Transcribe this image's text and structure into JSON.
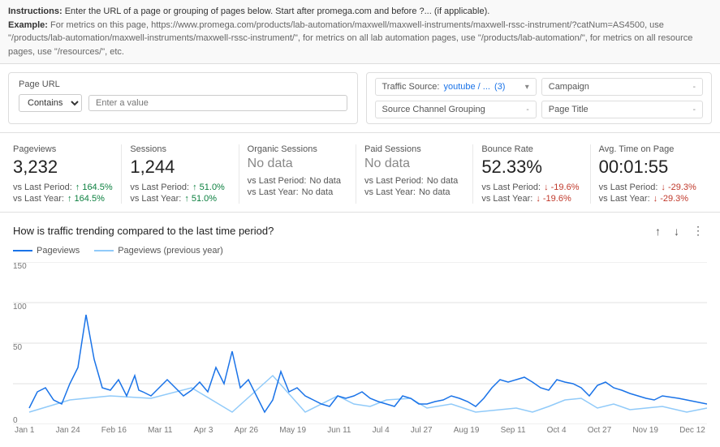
{
  "instructions": {
    "label": "Instructions:",
    "text": " Enter the URL of a page or grouping of pages below. Start after promega.com and before ?... (if applicable).",
    "example_label": "Example:",
    "example_text": " For metrics on this page, https://www.promega.com/products/lab-automation/maxwell/maxwell-instruments/maxwell-rssc-instrument/?catNum=AS4500, use \"/products/lab-automation/maxwell-instruments/maxwell-rssc-instrument/\", for metrics on all lab automation pages, use \"/products/lab-automation/\", for metrics on all resource pages, use \"/resources/\", etc."
  },
  "filters": {
    "page_url_label": "Page URL",
    "contains_label": "Contains",
    "enter_value_placeholder": "Enter a value",
    "traffic_source_label": "Traffic Source:",
    "traffic_source_value": "youtube / ...",
    "traffic_source_count": "(3)",
    "campaign_label": "Campaign",
    "campaign_dash": "-",
    "source_channel_label": "Source Channel Grouping",
    "source_channel_dash": "-",
    "page_title_label": "Page Title",
    "page_title_dash": "-"
  },
  "metrics": [
    {
      "id": "pageviews",
      "label": "Pageviews",
      "value": "3,232",
      "no_data": false,
      "vs_period_label": "vs Last Period:",
      "vs_period_value": "↑ 164.5%",
      "vs_period_dir": "up",
      "vs_year_label": "vs Last Year:",
      "vs_year_value": "↑ 164.5%",
      "vs_year_dir": "up"
    },
    {
      "id": "sessions",
      "label": "Sessions",
      "value": "1,244",
      "no_data": false,
      "vs_period_label": "vs Last Period:",
      "vs_period_value": "↑ 51.0%",
      "vs_period_dir": "up",
      "vs_year_label": "vs Last Year:",
      "vs_year_value": "↑ 51.0%",
      "vs_year_dir": "up"
    },
    {
      "id": "organic-sessions",
      "label": "Organic Sessions",
      "value": "No data",
      "no_data": true,
      "vs_period_label": "vs Last Period:",
      "vs_period_value": "No data",
      "vs_period_dir": "neutral",
      "vs_year_label": "vs Last Year:",
      "vs_year_value": "No data",
      "vs_year_dir": "neutral"
    },
    {
      "id": "paid-sessions",
      "label": "Paid Sessions",
      "value": "No data",
      "no_data": true,
      "vs_period_label": "vs Last Period:",
      "vs_period_value": "No data",
      "vs_period_dir": "neutral",
      "vs_year_label": "vs Last Year:",
      "vs_year_value": "No data",
      "vs_year_dir": "neutral"
    },
    {
      "id": "bounce-rate",
      "label": "Bounce Rate",
      "value": "52.33%",
      "no_data": false,
      "vs_period_label": "vs Last Period:",
      "vs_period_value": "↓ -19.6%",
      "vs_period_dir": "down",
      "vs_year_label": "vs Last Year:",
      "vs_year_value": "↓ -19.6%",
      "vs_year_dir": "down"
    },
    {
      "id": "avg-time",
      "label": "Avg. Time on Page",
      "value": "00:01:55",
      "no_data": false,
      "vs_period_label": "vs Last Period:",
      "vs_period_value": "↓ -29.3%",
      "vs_period_dir": "down",
      "vs_year_label": "vs Last Year:",
      "vs_year_value": "↓ -29.3%",
      "vs_year_dir": "down"
    }
  ],
  "chart": {
    "title": "How is traffic trending compared to the last time period?",
    "legend": [
      {
        "id": "pageviews",
        "label": "Pageviews",
        "color": "#1a73e8"
      },
      {
        "id": "pageviews-prev",
        "label": "Pageviews (previous year)",
        "color": "#90caf9"
      }
    ],
    "x_labels": [
      "Jan 1",
      "Jan 24",
      "Feb 16",
      "Mar 11",
      "Apr 3",
      "Apr 26",
      "May 19",
      "Jun 11",
      "Jul 4",
      "Jul 27",
      "Aug 19",
      "Sep 11",
      "Oct 4",
      "Oct 27",
      "Nov 19",
      "Dec 12"
    ],
    "y_max": 150,
    "y_labels": [
      "150",
      "100",
      "50",
      "0"
    ]
  }
}
